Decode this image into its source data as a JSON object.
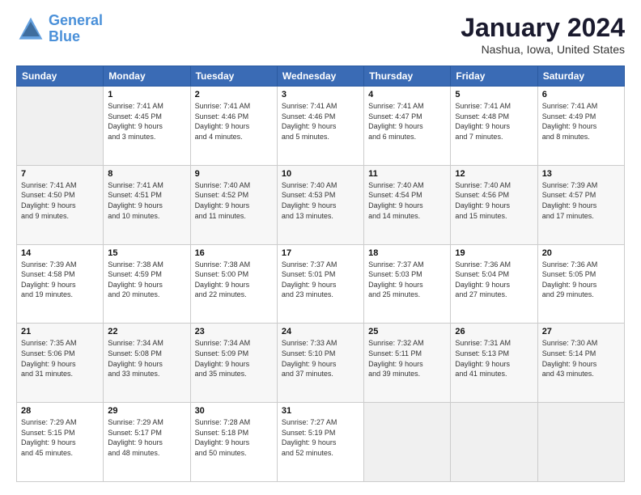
{
  "header": {
    "logo_line1": "General",
    "logo_line2": "Blue",
    "month_title": "January 2024",
    "location": "Nashua, Iowa, United States"
  },
  "days_of_week": [
    "Sunday",
    "Monday",
    "Tuesday",
    "Wednesday",
    "Thursday",
    "Friday",
    "Saturday"
  ],
  "weeks": [
    [
      {
        "day": "",
        "info": ""
      },
      {
        "day": "1",
        "info": "Sunrise: 7:41 AM\nSunset: 4:45 PM\nDaylight: 9 hours\nand 3 minutes."
      },
      {
        "day": "2",
        "info": "Sunrise: 7:41 AM\nSunset: 4:46 PM\nDaylight: 9 hours\nand 4 minutes."
      },
      {
        "day": "3",
        "info": "Sunrise: 7:41 AM\nSunset: 4:46 PM\nDaylight: 9 hours\nand 5 minutes."
      },
      {
        "day": "4",
        "info": "Sunrise: 7:41 AM\nSunset: 4:47 PM\nDaylight: 9 hours\nand 6 minutes."
      },
      {
        "day": "5",
        "info": "Sunrise: 7:41 AM\nSunset: 4:48 PM\nDaylight: 9 hours\nand 7 minutes."
      },
      {
        "day": "6",
        "info": "Sunrise: 7:41 AM\nSunset: 4:49 PM\nDaylight: 9 hours\nand 8 minutes."
      }
    ],
    [
      {
        "day": "7",
        "info": "Sunrise: 7:41 AM\nSunset: 4:50 PM\nDaylight: 9 hours\nand 9 minutes."
      },
      {
        "day": "8",
        "info": "Sunrise: 7:41 AM\nSunset: 4:51 PM\nDaylight: 9 hours\nand 10 minutes."
      },
      {
        "day": "9",
        "info": "Sunrise: 7:40 AM\nSunset: 4:52 PM\nDaylight: 9 hours\nand 11 minutes."
      },
      {
        "day": "10",
        "info": "Sunrise: 7:40 AM\nSunset: 4:53 PM\nDaylight: 9 hours\nand 13 minutes."
      },
      {
        "day": "11",
        "info": "Sunrise: 7:40 AM\nSunset: 4:54 PM\nDaylight: 9 hours\nand 14 minutes."
      },
      {
        "day": "12",
        "info": "Sunrise: 7:40 AM\nSunset: 4:56 PM\nDaylight: 9 hours\nand 15 minutes."
      },
      {
        "day": "13",
        "info": "Sunrise: 7:39 AM\nSunset: 4:57 PM\nDaylight: 9 hours\nand 17 minutes."
      }
    ],
    [
      {
        "day": "14",
        "info": "Sunrise: 7:39 AM\nSunset: 4:58 PM\nDaylight: 9 hours\nand 19 minutes."
      },
      {
        "day": "15",
        "info": "Sunrise: 7:38 AM\nSunset: 4:59 PM\nDaylight: 9 hours\nand 20 minutes."
      },
      {
        "day": "16",
        "info": "Sunrise: 7:38 AM\nSunset: 5:00 PM\nDaylight: 9 hours\nand 22 minutes."
      },
      {
        "day": "17",
        "info": "Sunrise: 7:37 AM\nSunset: 5:01 PM\nDaylight: 9 hours\nand 23 minutes."
      },
      {
        "day": "18",
        "info": "Sunrise: 7:37 AM\nSunset: 5:03 PM\nDaylight: 9 hours\nand 25 minutes."
      },
      {
        "day": "19",
        "info": "Sunrise: 7:36 AM\nSunset: 5:04 PM\nDaylight: 9 hours\nand 27 minutes."
      },
      {
        "day": "20",
        "info": "Sunrise: 7:36 AM\nSunset: 5:05 PM\nDaylight: 9 hours\nand 29 minutes."
      }
    ],
    [
      {
        "day": "21",
        "info": "Sunrise: 7:35 AM\nSunset: 5:06 PM\nDaylight: 9 hours\nand 31 minutes."
      },
      {
        "day": "22",
        "info": "Sunrise: 7:34 AM\nSunset: 5:08 PM\nDaylight: 9 hours\nand 33 minutes."
      },
      {
        "day": "23",
        "info": "Sunrise: 7:34 AM\nSunset: 5:09 PM\nDaylight: 9 hours\nand 35 minutes."
      },
      {
        "day": "24",
        "info": "Sunrise: 7:33 AM\nSunset: 5:10 PM\nDaylight: 9 hours\nand 37 minutes."
      },
      {
        "day": "25",
        "info": "Sunrise: 7:32 AM\nSunset: 5:11 PM\nDaylight: 9 hours\nand 39 minutes."
      },
      {
        "day": "26",
        "info": "Sunrise: 7:31 AM\nSunset: 5:13 PM\nDaylight: 9 hours\nand 41 minutes."
      },
      {
        "day": "27",
        "info": "Sunrise: 7:30 AM\nSunset: 5:14 PM\nDaylight: 9 hours\nand 43 minutes."
      }
    ],
    [
      {
        "day": "28",
        "info": "Sunrise: 7:29 AM\nSunset: 5:15 PM\nDaylight: 9 hours\nand 45 minutes."
      },
      {
        "day": "29",
        "info": "Sunrise: 7:29 AM\nSunset: 5:17 PM\nDaylight: 9 hours\nand 48 minutes."
      },
      {
        "day": "30",
        "info": "Sunrise: 7:28 AM\nSunset: 5:18 PM\nDaylight: 9 hours\nand 50 minutes."
      },
      {
        "day": "31",
        "info": "Sunrise: 7:27 AM\nSunset: 5:19 PM\nDaylight: 9 hours\nand 52 minutes."
      },
      {
        "day": "",
        "info": ""
      },
      {
        "day": "",
        "info": ""
      },
      {
        "day": "",
        "info": ""
      }
    ]
  ]
}
